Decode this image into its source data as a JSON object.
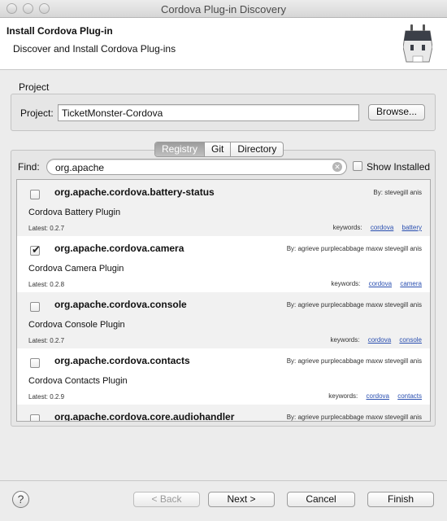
{
  "window": {
    "title": "Cordova Plug-in Discovery"
  },
  "header": {
    "title": "Install Cordova Plug-in",
    "subtitle": "Discover and Install Cordova Plug-ins",
    "icon": "cordova-robot-icon"
  },
  "project": {
    "group_label": "Project",
    "label": "Project:",
    "value": "TicketMonster-Cordova",
    "browse_label": "Browse..."
  },
  "source_tabs": [
    {
      "label": "Registry",
      "selected": true
    },
    {
      "label": "Git",
      "selected": false
    },
    {
      "label": "Directory",
      "selected": false
    }
  ],
  "search": {
    "label": "Find:",
    "value": "org.apache",
    "show_installed_label": "Show Installed",
    "show_installed_checked": false
  },
  "plugins": [
    {
      "name": "org.apache.cordova.battery-status",
      "by": "By: stevegill anis",
      "description": "Cordova Battery Plugin",
      "latest": "Latest: 0.2.7",
      "keywords_label": "keywords:",
      "keywords": [
        "cordova",
        "battery"
      ],
      "checked": false
    },
    {
      "name": "org.apache.cordova.camera",
      "by": "By: agrieve purplecabbage maxw stevegill anis",
      "description": "Cordova Camera Plugin",
      "latest": "Latest: 0.2.8",
      "keywords_label": "keywords:",
      "keywords": [
        "cordova",
        "camera"
      ],
      "checked": true
    },
    {
      "name": "org.apache.cordova.console",
      "by": "By: agrieve purplecabbage maxw stevegill anis",
      "description": "Cordova Console Plugin",
      "latest": "Latest: 0.2.7",
      "keywords_label": "keywords:",
      "keywords": [
        "cordova",
        "console"
      ],
      "checked": false
    },
    {
      "name": "org.apache.cordova.contacts",
      "by": "By: agrieve purplecabbage maxw stevegill anis",
      "description": "Cordova Contacts Plugin",
      "latest": "Latest: 0.2.9",
      "keywords_label": "keywords:",
      "keywords": [
        "cordova",
        "contacts"
      ],
      "checked": false
    },
    {
      "name": "org.apache.cordova.core.audiohandler",
      "by": "By: agrieve purplecabbage maxw stevegill anis",
      "description": "",
      "latest": "",
      "keywords_label": "",
      "keywords": [],
      "checked": false
    }
  ],
  "footer": {
    "help_icon": "question-mark-icon",
    "back_label": "< Back",
    "next_label": "Next >",
    "cancel_label": "Cancel",
    "finish_label": "Finish"
  }
}
